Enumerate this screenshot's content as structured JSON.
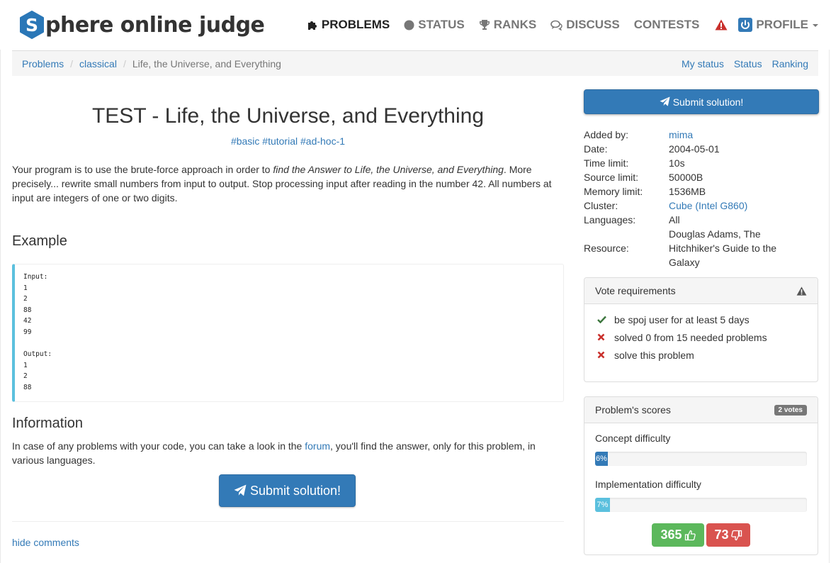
{
  "brand": {
    "badge_letter": "S",
    "name": "phere online judge"
  },
  "nav": {
    "problems": "PROBLEMS",
    "status": "STATUS",
    "ranks": "RANKS",
    "discuss": "DISCUSS",
    "contests": "CONTESTS",
    "profile": "PROFILE"
  },
  "breadcrumb": {
    "items": [
      "Problems",
      "classical",
      "Life, the Universe, and Everything"
    ],
    "links": [
      "My status",
      "Status",
      "Ranking"
    ]
  },
  "problem": {
    "title": "TEST - Life, the Universe, and Everything",
    "tags": [
      "#basic",
      "#tutorial",
      "#ad-hoc-1"
    ],
    "desc_before": "Your program is to use the brute-force approach in order to ",
    "desc_italic": "find the Answer to Life, the Universe, and Everything",
    "desc_after": ". More precisely... rewrite small numbers from input to output. Stop processing input after reading in the number 42. All numbers at input are integers of one or two digits.",
    "example_heading": "Example",
    "example_code": "Input:\n1\n2\n88\n42\n99\n\nOutput:\n1\n2\n88",
    "info_heading": "Information",
    "info_before": "In case of any problems with your code, you can take a look in the ",
    "info_link": "forum",
    "info_after": ", you'll find the answer, only for this problem, in various languages.",
    "submit_label": "Submit solution!",
    "hide_comments": "hide comments"
  },
  "side": {
    "submit_label": "Submit solution!",
    "meta": [
      {
        "key": "Added by:",
        "value": "mima"
      },
      {
        "key": "Date:",
        "value": "2004-05-01"
      },
      {
        "key": "Time limit:",
        "value": "10s"
      },
      {
        "key": "Source limit:",
        "value": "50000B"
      },
      {
        "key": "Memory limit:",
        "value": "1536MB"
      },
      {
        "key": "Cluster:",
        "value": "Cube (Intel G860)"
      },
      {
        "key": "Languages:",
        "value": "All"
      },
      {
        "key": "Resource:",
        "value": "Douglas Adams, The Hitchhiker's Guide to the Galaxy"
      }
    ],
    "vote_requirements": {
      "heading": "Vote requirements",
      "items": [
        {
          "text": "be spoj user for at least 5 days",
          "ok": true
        },
        {
          "text": "solved 0 from 15 needed problems",
          "ok": false
        },
        {
          "text": "solve this problem",
          "ok": false
        }
      ]
    },
    "scores": {
      "heading": "Problem's scores",
      "votes_badge": "2 votes",
      "concept_label": "Concept difficulty",
      "concept_text": "6%",
      "concept_value": 6,
      "impl_label": "Implementation difficulty",
      "impl_text": "7%",
      "impl_value": 7,
      "likes": "365",
      "dislikes": "73"
    }
  },
  "colors": {
    "link": "#337ab7",
    "primary": "#337ab7",
    "info": "#5bc0de",
    "success": "#5cb85c",
    "danger": "#d9534f",
    "logo_blue": "#2a77b7"
  }
}
